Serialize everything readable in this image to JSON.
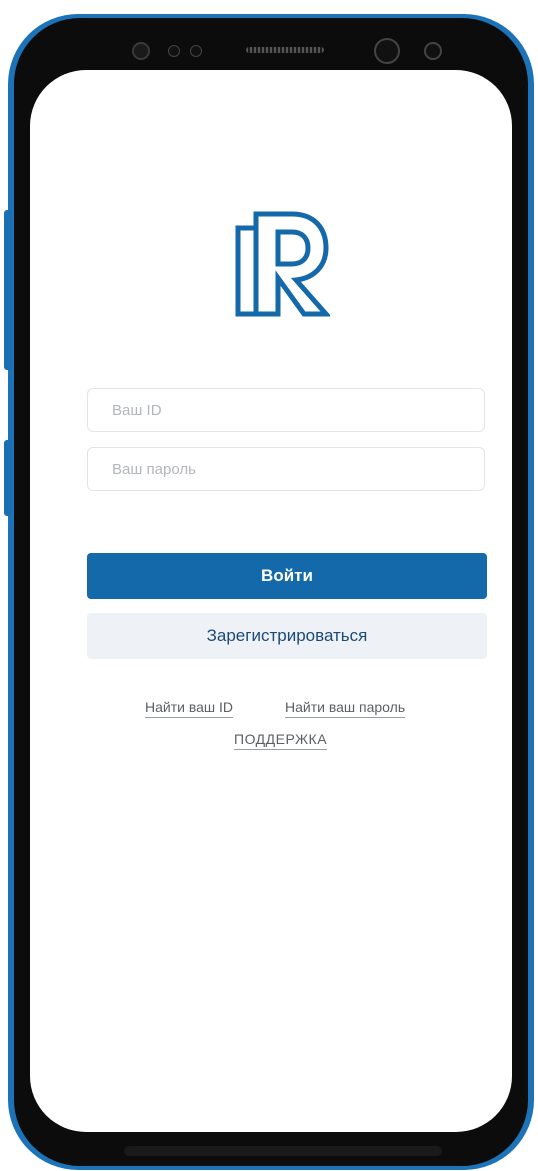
{
  "login_form": {
    "id_placeholder": "Ваш ID",
    "password_placeholder": "Ваш пароль",
    "login_label": "Войти",
    "register_label": "Зарегистрироваться"
  },
  "links": {
    "find_id": "Найти ваш ID",
    "find_password": "Найти ваш пароль",
    "support": "ПОДДЕРЖКА"
  },
  "colors": {
    "primary": "#1469aa",
    "frame": "#1c73b8",
    "secondary_button_bg": "#eef1f5"
  },
  "icons": {
    "logo": "r-logo-icon"
  }
}
